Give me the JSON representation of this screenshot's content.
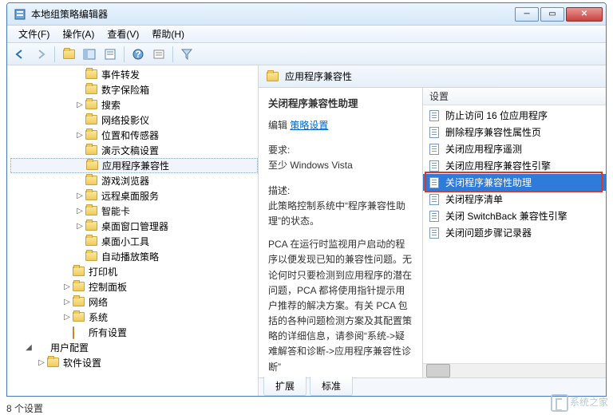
{
  "window": {
    "title": "本地组策略编辑器"
  },
  "menu": {
    "file": "文件(F)",
    "action": "操作(A)",
    "view": "查看(V)",
    "help": "帮助(H)"
  },
  "tree": {
    "items": [
      {
        "label": "事件转发",
        "indent": 5,
        "exp": ""
      },
      {
        "label": "数字保险箱",
        "indent": 5,
        "exp": ""
      },
      {
        "label": "搜索",
        "indent": 5,
        "exp": "▷"
      },
      {
        "label": "网络投影仪",
        "indent": 5,
        "exp": ""
      },
      {
        "label": "位置和传感器",
        "indent": 5,
        "exp": "▷"
      },
      {
        "label": "演示文稿设置",
        "indent": 5,
        "exp": ""
      },
      {
        "label": "应用程序兼容性",
        "indent": 5,
        "exp": "",
        "sel": true
      },
      {
        "label": "游戏浏览器",
        "indent": 5,
        "exp": ""
      },
      {
        "label": "远程桌面服务",
        "indent": 5,
        "exp": "▷"
      },
      {
        "label": "智能卡",
        "indent": 5,
        "exp": "▷"
      },
      {
        "label": "桌面窗口管理器",
        "indent": 5,
        "exp": "▷"
      },
      {
        "label": "桌面小工具",
        "indent": 5,
        "exp": ""
      },
      {
        "label": "自动播放策略",
        "indent": 5,
        "exp": ""
      },
      {
        "label": "打印机",
        "indent": 4,
        "exp": ""
      },
      {
        "label": "控制面板",
        "indent": 4,
        "exp": "▷"
      },
      {
        "label": "网络",
        "indent": 4,
        "exp": "▷"
      },
      {
        "label": "系统",
        "indent": 4,
        "exp": "▷"
      },
      {
        "label": "所有设置",
        "indent": 4,
        "exp": "",
        "icon": "all"
      },
      {
        "label": "用户配置",
        "indent": 1,
        "exp": "◢",
        "icon": "gear"
      },
      {
        "label": "软件设置",
        "indent": 2,
        "exp": "▷"
      }
    ]
  },
  "right": {
    "header": "应用程序兼容性",
    "detail": {
      "title": "关闭程序兼容性助理",
      "editPrefix": "编辑",
      "editLink": "策略设置",
      "reqLabel": "要求:",
      "reqValue": "至少 Windows Vista",
      "descLabel": "描述:",
      "descBody": "此策略控制系统中“程序兼容性助理”的状态。",
      "pcaBody": "PCA 在运行时监视用户启动的程序以便发现已知的兼容性问题。无论何时只要检测到应用程序的潜在问题，PCA 都将使用指针提示用户推荐的解决方案。有关 PCA 包括的各种问题检测方案及其配置策略的详细信息，请参阅“系统->疑难解答和诊断->应用程序兼容性诊断”"
    },
    "list": {
      "header": "设置",
      "items": [
        "防止访问 16 位应用程序",
        "删除程序兼容性属性页",
        "关闭应用程序遥测",
        "关闭应用程序兼容性引擎",
        "关闭程序兼容性助理",
        "关闭程序清单",
        "关闭 SwitchBack 兼容性引擎",
        "关闭问题步骤记录器"
      ],
      "selectedIndex": 4
    },
    "tabs": {
      "extended": "扩展",
      "standard": "标准"
    }
  },
  "status": "8 个设置",
  "watermark": "系统之家"
}
